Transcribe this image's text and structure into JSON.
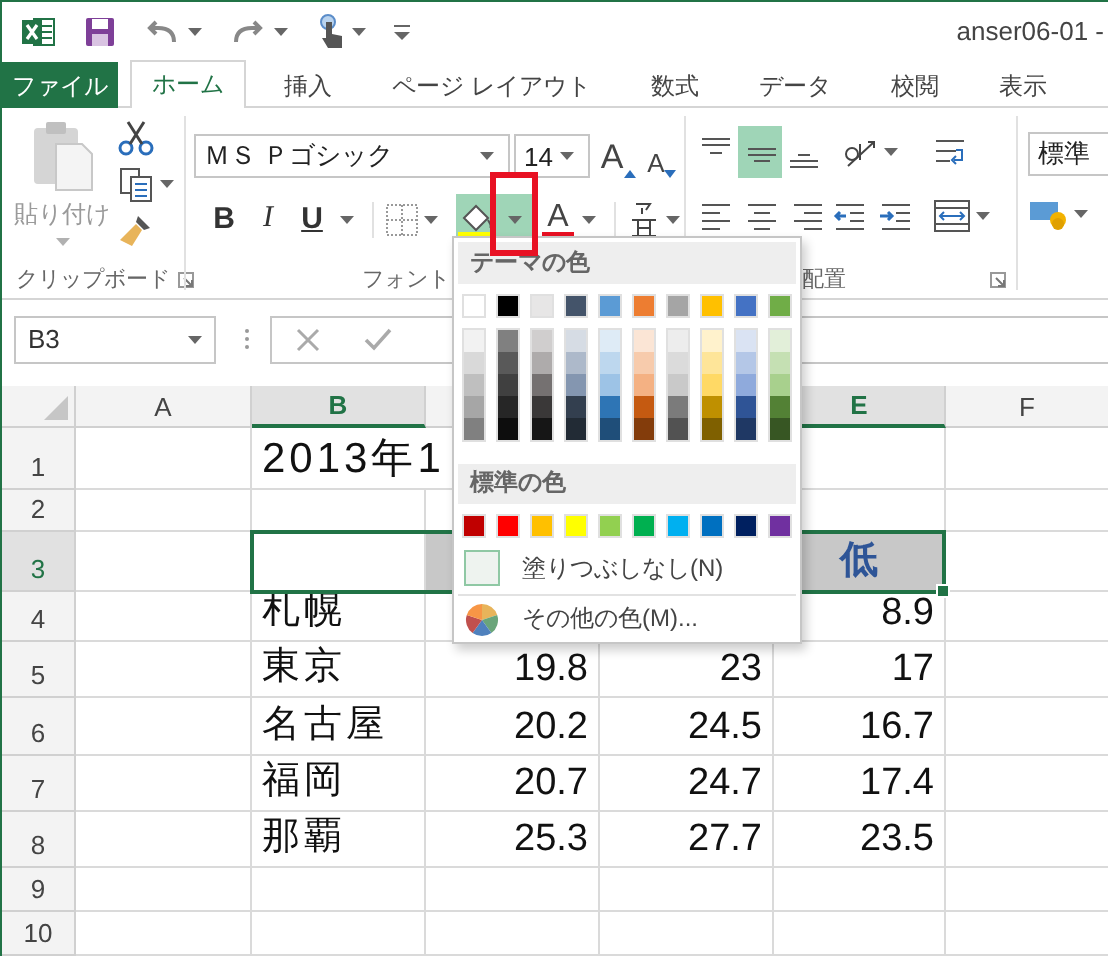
{
  "window": {
    "title": "anser06-01 -"
  },
  "tabs": [
    {
      "label": "ファイル",
      "kind": "file",
      "selected": false
    },
    {
      "label": "ホーム",
      "kind": "tab",
      "selected": true
    },
    {
      "label": "挿入",
      "kind": "tab",
      "selected": false
    },
    {
      "label": "ページ レイアウト",
      "kind": "tab",
      "selected": false
    },
    {
      "label": "数式",
      "kind": "tab",
      "selected": false
    },
    {
      "label": "データ",
      "kind": "tab",
      "selected": false
    },
    {
      "label": "校閲",
      "kind": "tab",
      "selected": false
    },
    {
      "label": "表示",
      "kind": "tab",
      "selected": false
    }
  ],
  "ribbon": {
    "clipboard": {
      "label": "クリップボード",
      "paste_label": "貼り付け",
      "paste_disabled": true
    },
    "font": {
      "label": "フォント",
      "font_name": "ＭＳ Ｐゴシック",
      "font_size": "14",
      "grow_label": "A",
      "shrink_label": "A",
      "font_color_label": "A",
      "style_buttons": [
        {
          "kind": "bold",
          "label": "B"
        },
        {
          "kind": "italic",
          "label": "I"
        },
        {
          "kind": "underline",
          "label": "U"
        }
      ],
      "fill_dropdown_open": true,
      "fill_dropdown_highlighted": true
    },
    "alignment": {
      "label": "配置",
      "vertical_align": [
        {
          "kind": "top",
          "selected": false
        },
        {
          "kind": "middle",
          "selected": true
        },
        {
          "kind": "bottom",
          "selected": false
        }
      ]
    },
    "number": {
      "format": "標準"
    }
  },
  "formula_bar": {
    "name_box": "B3"
  },
  "sheet": {
    "columns": [
      {
        "label": "A",
        "selected": false
      },
      {
        "label": "B",
        "selected": true
      },
      {},
      {},
      {
        "label": "E",
        "selected": true
      },
      {
        "label": "F",
        "selected": false
      }
    ],
    "rows": [
      {
        "label": "1",
        "selected": false,
        "cells": {
          "b": {
            "text": "2013年1",
            "kind": "title"
          }
        }
      },
      {
        "label": "2",
        "selected": false,
        "cells": {}
      },
      {
        "label": "3",
        "selected": true,
        "cells": {
          "c": {
            "shaded": true
          },
          "e": {
            "text": "低",
            "shaded": true
          }
        }
      },
      {
        "label": "4",
        "selected": false,
        "cells": {
          "b": "札幌",
          "e": "8.9"
        }
      },
      {
        "label": "5",
        "selected": false,
        "cells": {
          "b": "東京",
          "c": "19.8",
          "d": "23",
          "e": "17"
        }
      },
      {
        "label": "6",
        "selected": false,
        "cells": {
          "b": "名古屋",
          "c": "20.2",
          "d": "24.5",
          "e": "16.7"
        }
      },
      {
        "label": "7",
        "selected": false,
        "cells": {
          "b": "福岡",
          "c": "20.7",
          "d": "24.7",
          "e": "17.4"
        }
      },
      {
        "label": "8",
        "selected": false,
        "cells": {
          "b": "那覇",
          "c": "25.3",
          "d": "27.7",
          "e": "23.5"
        }
      },
      {
        "label": "9",
        "selected": false,
        "cells": {}
      },
      {
        "label": "10",
        "selected": false,
        "cells": {}
      }
    ]
  },
  "fill_menu": {
    "theme_title": "テーマの色",
    "standard_title": "標準の色",
    "theme_colors": [
      {
        "color": "#ffffff",
        "shades": [
          {
            "color": "#f2f2f2"
          },
          {
            "color": "#d9d9d9"
          },
          {
            "color": "#bfbfbf"
          },
          {
            "color": "#a6a6a6"
          },
          {
            "color": "#808080"
          }
        ]
      },
      {
        "color": "#000000",
        "shades": [
          {
            "color": "#808080"
          },
          {
            "color": "#595959"
          },
          {
            "color": "#404040"
          },
          {
            "color": "#262626"
          },
          {
            "color": "#0d0d0d"
          }
        ]
      },
      {
        "color": "#e7e6e6",
        "shades": [
          {
            "color": "#d0cece"
          },
          {
            "color": "#aeabab"
          },
          {
            "color": "#757171"
          },
          {
            "color": "#3a3838"
          },
          {
            "color": "#161616"
          }
        ]
      },
      {
        "color": "#44546a",
        "shades": [
          {
            "color": "#d6dce4"
          },
          {
            "color": "#adb9ca"
          },
          {
            "color": "#8496b0"
          },
          {
            "color": "#333f4f"
          },
          {
            "color": "#222b35"
          }
        ]
      },
      {
        "color": "#5b9bd5",
        "shades": [
          {
            "color": "#deebf6"
          },
          {
            "color": "#bdd7ee"
          },
          {
            "color": "#9dc3e6"
          },
          {
            "color": "#2e75b5"
          },
          {
            "color": "#1f4e79"
          }
        ]
      },
      {
        "color": "#ed7d31",
        "shades": [
          {
            "color": "#fbe5d5"
          },
          {
            "color": "#f7cbac"
          },
          {
            "color": "#f4b183"
          },
          {
            "color": "#c55a11"
          },
          {
            "color": "#833c0b"
          }
        ]
      },
      {
        "color": "#a5a5a5",
        "shades": [
          {
            "color": "#ededed"
          },
          {
            "color": "#dbdbdb"
          },
          {
            "color": "#c9c9c9"
          },
          {
            "color": "#7b7b7b"
          },
          {
            "color": "#525252"
          }
        ]
      },
      {
        "color": "#ffc000",
        "shades": [
          {
            "color": "#fff2cc"
          },
          {
            "color": "#fee599"
          },
          {
            "color": "#ffd965"
          },
          {
            "color": "#bf9000"
          },
          {
            "color": "#7f6000"
          }
        ]
      },
      {
        "color": "#4472c4",
        "shades": [
          {
            "color": "#dae3f3"
          },
          {
            "color": "#b4c7e7"
          },
          {
            "color": "#8faadc"
          },
          {
            "color": "#2f5496"
          },
          {
            "color": "#1f3864"
          }
        ]
      },
      {
        "color": "#70ad47",
        "shades": [
          {
            "color": "#e2efd9"
          },
          {
            "color": "#c5e0b3"
          },
          {
            "color": "#a8d08d"
          },
          {
            "color": "#538135"
          },
          {
            "color": "#375623"
          }
        ]
      }
    ],
    "standard_colors": [
      {
        "color": "#c00000"
      },
      {
        "color": "#ff0000"
      },
      {
        "color": "#ffc000"
      },
      {
        "color": "#ffff00"
      },
      {
        "color": "#92d050"
      },
      {
        "color": "#00b050"
      },
      {
        "color": "#00b0f0"
      },
      {
        "color": "#0070c0"
      },
      {
        "color": "#002060"
      },
      {
        "color": "#7030a0"
      }
    ],
    "items": [
      {
        "kind": "no_fill",
        "label": "塗りつぶしなし(N)"
      },
      {
        "kind": "more_colors",
        "label": "その他の色(M)..."
      }
    ]
  }
}
